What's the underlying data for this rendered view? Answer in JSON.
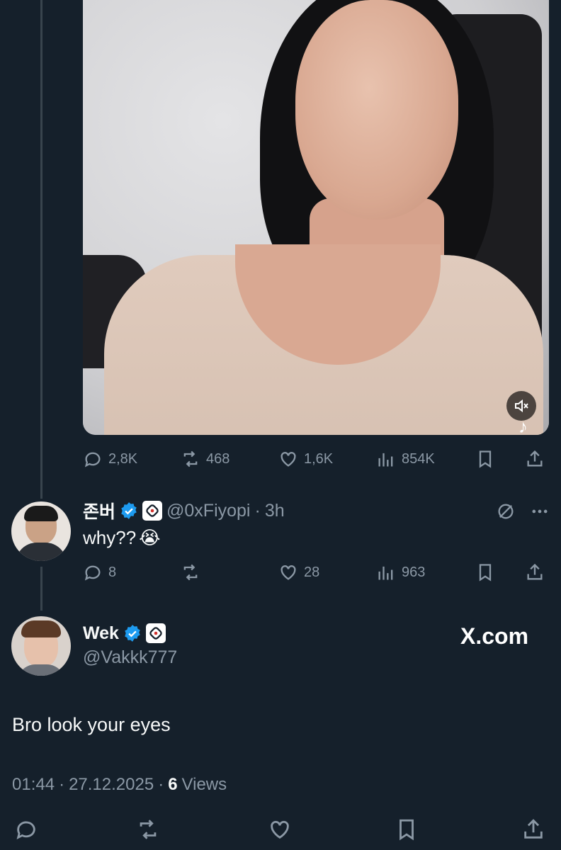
{
  "media": {
    "mute_icon": "mute-speaker-icon",
    "watermark_icon": "tiktok-icon"
  },
  "main_actions": {
    "replies": "2,8K",
    "reposts": "468",
    "likes": "1,6K",
    "views": "854K"
  },
  "reply": {
    "name": "존버",
    "handle": "@0xFiyopi",
    "separator": "·",
    "time": "3h",
    "text": "why??",
    "emoji": "😭",
    "replies": "8",
    "reposts": "",
    "likes": "28",
    "views": "963"
  },
  "focus": {
    "name": "Wek",
    "handle": "@Vakkk777",
    "watermark": "X.com",
    "text": "Bro look your eyes",
    "time": "01:44",
    "sep1": "·",
    "date": "27.12.2025",
    "sep2": "·",
    "views_count": "6",
    "views_label": "Views"
  },
  "colors": {
    "background": "#15202b",
    "muted": "#8b98a5",
    "verified": "#1d9bf0",
    "text": "#f7f9f9"
  }
}
